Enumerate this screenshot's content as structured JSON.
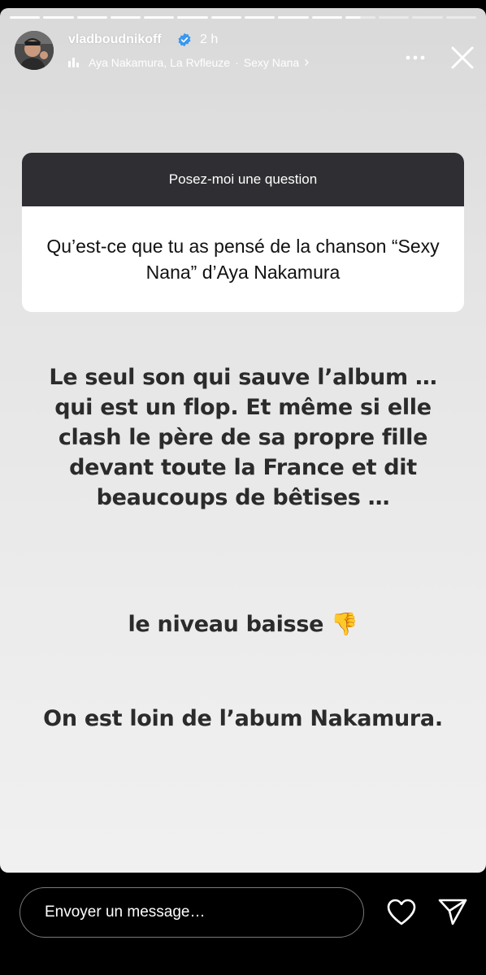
{
  "header": {
    "username": "vladboudnikoff",
    "time": "2 h",
    "music_artists": "Aya Nakamura, La Rvfleuze",
    "music_separator": "·",
    "music_title": "Sexy Nana",
    "music_chevron": "›"
  },
  "question_sticker": {
    "title": "Posez-moi une question",
    "question": "Qu’est-ce que tu as pensé de la chanson “Sexy Nana” d’Aya Nakamura"
  },
  "answer": {
    "line1": "Le seul son qui sauve l’album …  qui est un flop. Et même si elle clash le père de sa propre fille devant toute la France et dit beaucoups de bêtises …",
    "line2": "le niveau baisse",
    "emoji": "👎",
    "line3": "On est loin de l’abum Nakamura."
  },
  "footer": {
    "message_placeholder": "Envoyer un message…"
  },
  "icons": {
    "verified": "verified-badge-icon",
    "music": "music-bars-icon",
    "more": "more-dots-icon",
    "close": "close-icon",
    "like": "heart-icon",
    "share": "send-icon"
  },
  "colors": {
    "sticker_header": "#2f2f33",
    "answer_text": "#2b2b2b",
    "background": "#e4e4e4",
    "verified_blue": "#3897f0"
  }
}
